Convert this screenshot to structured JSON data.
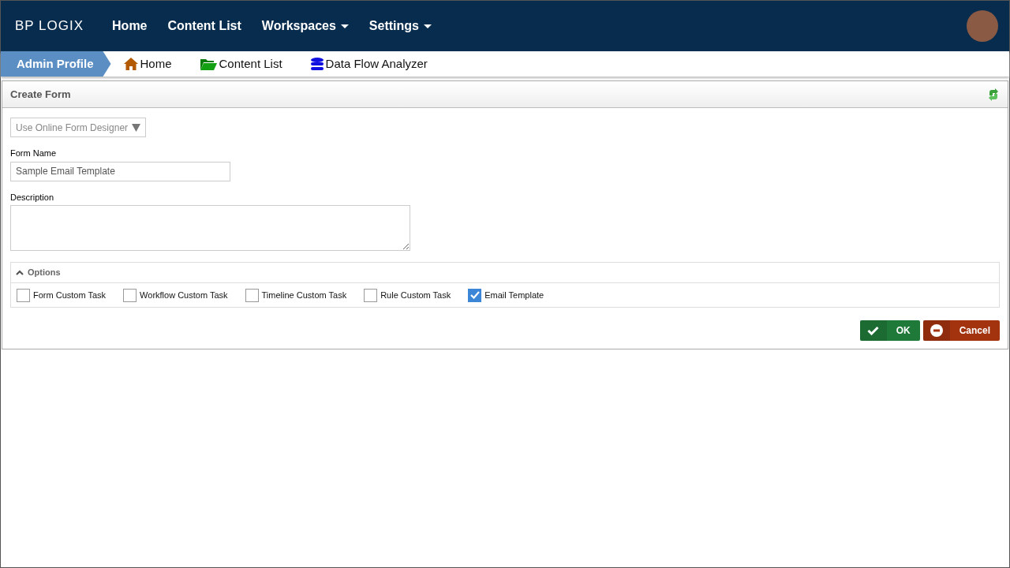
{
  "brand": {
    "text": "BP LOGIX"
  },
  "nav": [
    {
      "label": "Home",
      "dropdown": false
    },
    {
      "label": "Content List",
      "dropdown": false
    },
    {
      "label": "Workspaces",
      "dropdown": true
    },
    {
      "label": "Settings",
      "dropdown": true
    }
  ],
  "breadcrumb": {
    "current": "Admin Profile",
    "links": [
      {
        "label": "Home",
        "kind": "home"
      },
      {
        "label": "Content List",
        "kind": "folder"
      },
      {
        "label": "Data Flow Analyzer",
        "kind": "database"
      }
    ]
  },
  "panel": {
    "title": "Create Form",
    "designer_select": {
      "value": "Use Online Form Designer"
    },
    "form_name": {
      "label": "Form Name",
      "value": "Sample Email Template"
    },
    "description": {
      "label": "Description"
    },
    "options": {
      "title": "Options",
      "expanded": true,
      "items": [
        {
          "label": "Form Custom Task",
          "checked": false
        },
        {
          "label": "Workflow Custom Task",
          "checked": false
        },
        {
          "label": "Timeline Custom Task",
          "checked": false
        },
        {
          "label": "Rule Custom Task",
          "checked": false
        },
        {
          "label": "Email Template",
          "checked": true
        }
      ]
    },
    "buttons": [
      {
        "label": "OK",
        "kind": "ok"
      },
      {
        "label": "Cancel",
        "kind": "cancel"
      }
    ]
  }
}
